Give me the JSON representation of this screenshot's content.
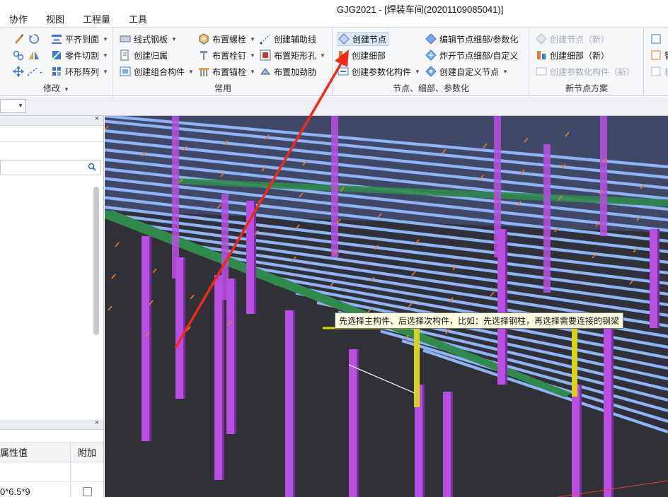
{
  "window": {
    "title": "GJG2021 - [焊装车间(20201109085041)]"
  },
  "menu": {
    "items": [
      "协作",
      "视图",
      "工程量",
      "工具"
    ]
  },
  "ribbon": {
    "modify": {
      "label": "修改",
      "buttons": [
        "平齐到面",
        "零件切割",
        "环形阵列"
      ]
    },
    "common": {
      "label": "常用",
      "buttons": [
        "线式钢板",
        "创建归属",
        "创建组合构件",
        "布置螺栓",
        "布置栓钉",
        "布置锚栓",
        "创建辅助线",
        "布置矩形孔",
        "布置加劲肋"
      ]
    },
    "nodes": {
      "label": "节点、细部、参数化",
      "buttons": [
        "创建节点",
        "创建细部",
        "创建参数化构件",
        "编辑节点细部/参数化",
        "炸开节点细部/自定义",
        "创建自定义节点"
      ]
    },
    "new_scheme": {
      "label": "新节点方案",
      "buttons": [
        "创建节点（新）",
        "创建细部（新）",
        "创建参数化构件（新）"
      ]
    },
    "partial": {
      "buttons": [
        "",
        "智",
        "模"
      ]
    }
  },
  "props": {
    "col_value": "属性值",
    "col_extra": "附加",
    "rows": [
      {
        "value": "0*6.5*9",
        "extra": false
      }
    ]
  },
  "viewport": {
    "tooltip": "先选择主构件、后选择次构件，比如：先选择钢柱，再选择需要连接的钢梁"
  },
  "colors": {
    "purlin": "#8fb3f5",
    "column": "#b84fe0",
    "beam": "#2f8a4b",
    "selected": "#d8d21a",
    "annotation_arrow": "#f02a1a",
    "background": "#2f3136"
  }
}
